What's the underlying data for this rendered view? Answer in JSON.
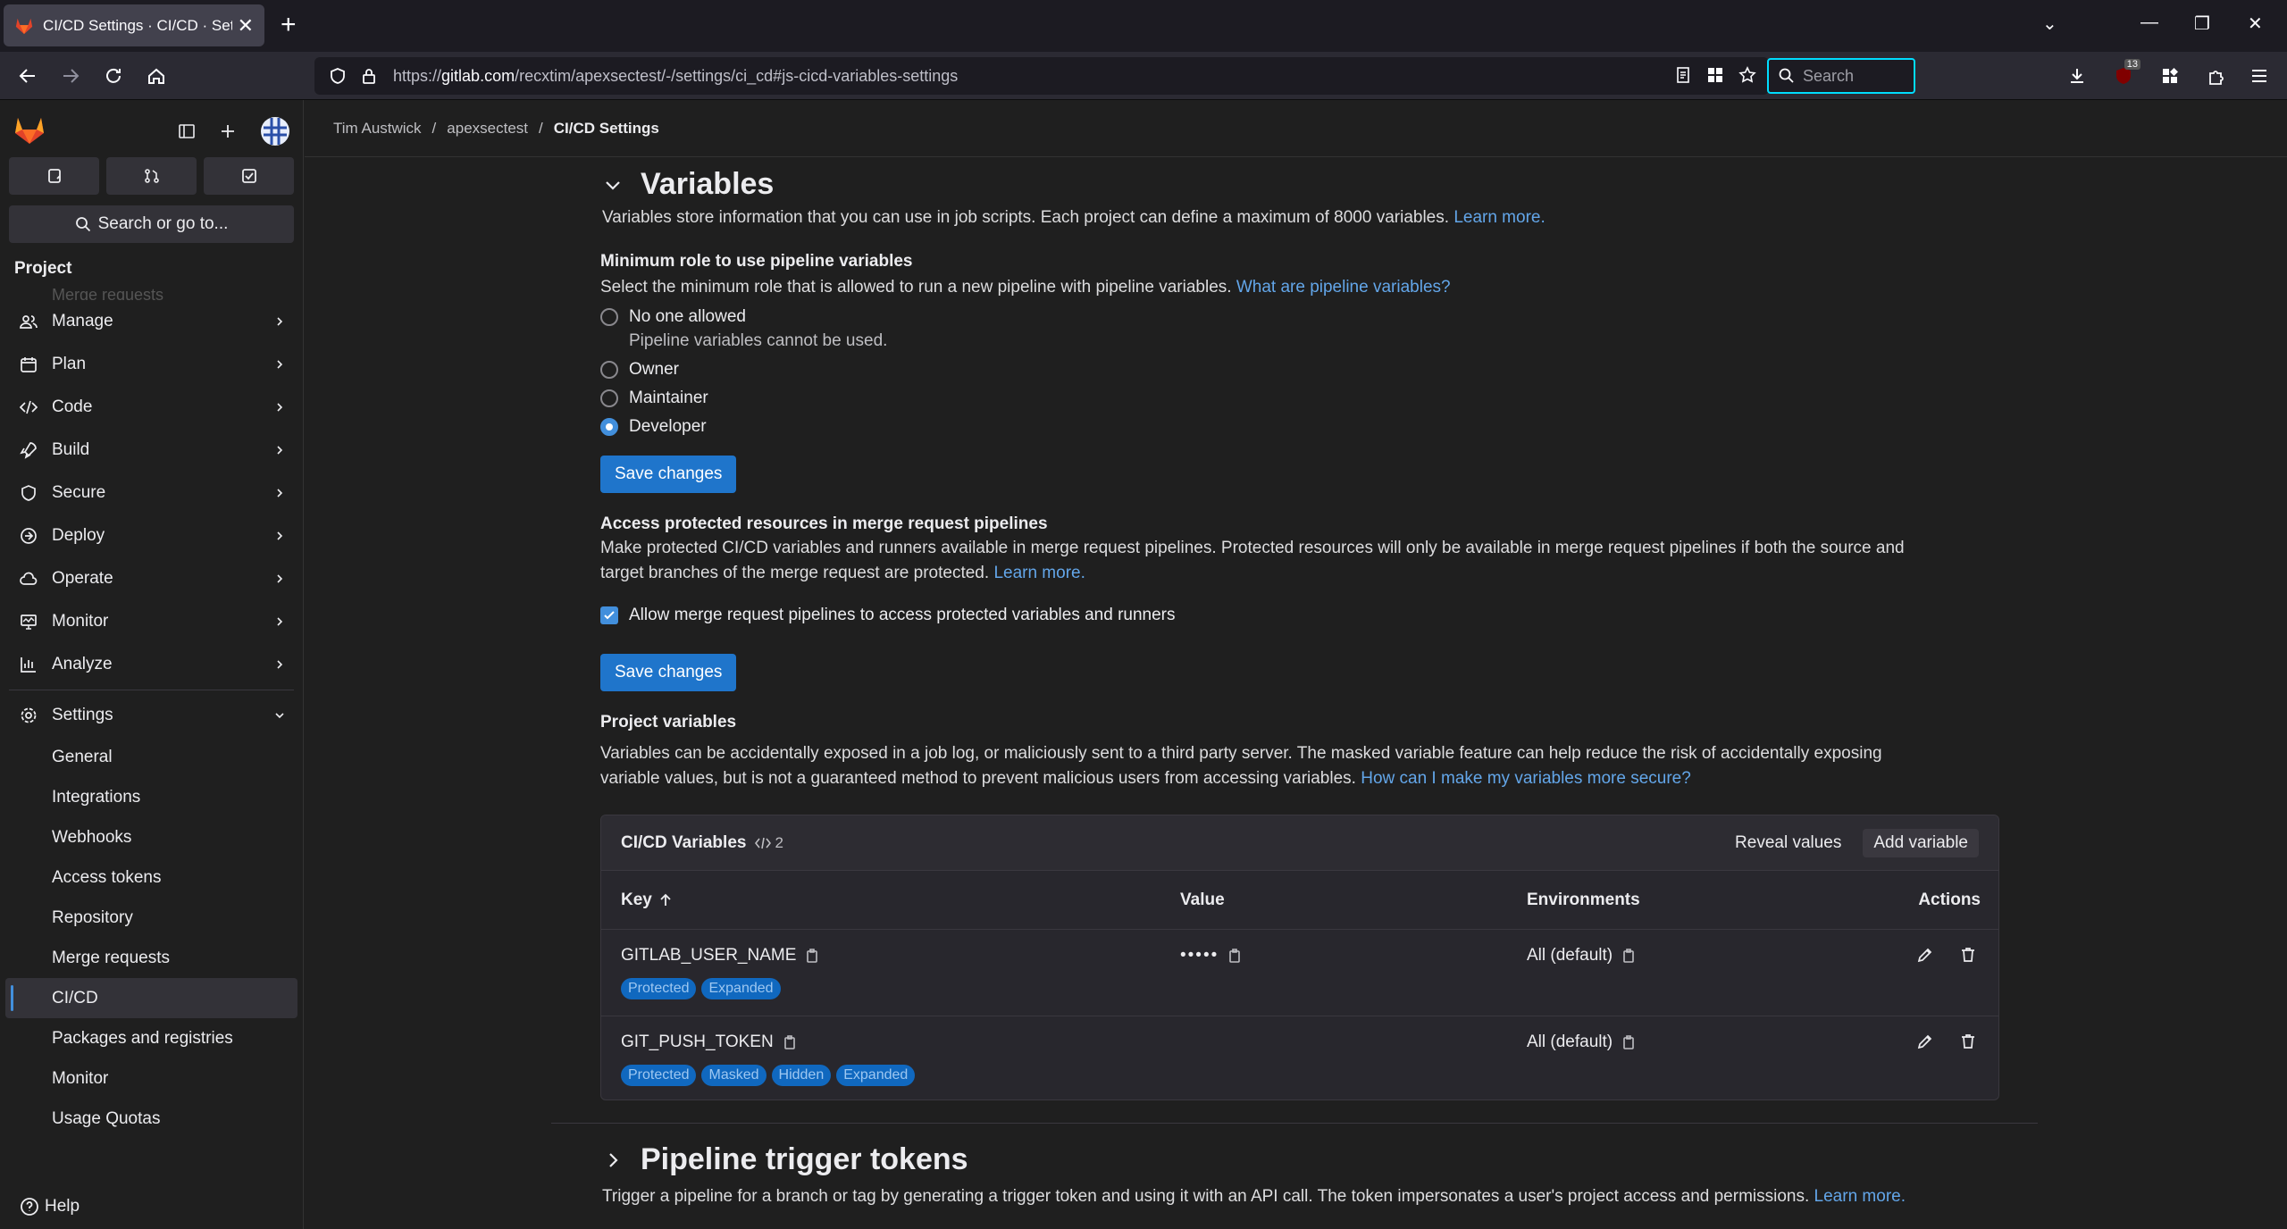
{
  "browser": {
    "tab_title": "CI/CD Settings · CI/CD · Settings",
    "url_prefix": "https://",
    "url_domain": "gitlab.com",
    "url_path": "/recxtim/apexsectest/-/settings/ci_cd#js-cicd-variables-settings",
    "search_placeholder": "Search",
    "badge_count": "13"
  },
  "sidebar": {
    "search_label": "Search or go to...",
    "section": "Project",
    "faded_item": "Merge requests",
    "nav": [
      {
        "label": "Manage",
        "icon": "users-icon"
      },
      {
        "label": "Plan",
        "icon": "calendar-icon"
      },
      {
        "label": "Code",
        "icon": "code-icon"
      },
      {
        "label": "Build",
        "icon": "rocket-icon"
      },
      {
        "label": "Secure",
        "icon": "shield-icon"
      },
      {
        "label": "Deploy",
        "icon": "deploy-icon"
      },
      {
        "label": "Operate",
        "icon": "cloud-icon"
      },
      {
        "label": "Monitor",
        "icon": "monitor-icon"
      },
      {
        "label": "Analyze",
        "icon": "chart-icon"
      }
    ],
    "settings_label": "Settings",
    "settings_items": [
      "General",
      "Integrations",
      "Webhooks",
      "Access tokens",
      "Repository",
      "Merge requests",
      "CI/CD",
      "Packages and registries",
      "Monitor",
      "Usage Quotas"
    ],
    "active_item": "CI/CD",
    "help": "Help"
  },
  "breadcrumb": [
    "Tim Austwick",
    "apexsectest",
    "CI/CD Settings"
  ],
  "variables_section": {
    "title": "Variables",
    "description": "Variables store information that you can use in job scripts. Each project can define a maximum of 8000 variables.",
    "learn_more": "Learn more.",
    "min_role": {
      "label": "Minimum role to use pipeline variables",
      "description": "Select the minimum role that is allowed to run a new pipeline with pipeline variables.",
      "link": "What are pipeline variables?",
      "options": [
        "No one allowed",
        "Owner",
        "Maintainer",
        "Developer"
      ],
      "no_one_hint": "Pipeline variables cannot be used.",
      "selected": "Developer"
    },
    "save_changes": "Save changes",
    "protected": {
      "label": "Access protected resources in merge request pipelines",
      "description_line1": "Make protected CI/CD variables and runners available in merge request pipelines. Protected resources will only be available in merge request pipelines if both the source and",
      "description_line2": "target branches of the merge request are protected.",
      "learn_more": "Learn more.",
      "checkbox": "Allow merge request pipelines to access protected variables and runners",
      "checked": true
    },
    "project_vars": {
      "label": "Project variables",
      "warning_line1": "Variables can be accidentally exposed in a job log, or maliciously sent to a third party server. The masked variable feature can help reduce the risk of accidentally exposing",
      "warning_line2": "variable values, but is not a guaranteed method to prevent malicious users from accessing variables.",
      "warning_link": "How can I make my variables more secure?"
    },
    "table": {
      "title": "CI/CD Variables",
      "count": "2",
      "reveal": "Reveal values",
      "add": "Add variable",
      "headers": {
        "key": "Key",
        "value": "Value",
        "environments": "Environments",
        "actions": "Actions"
      },
      "rows": [
        {
          "key": "GITLAB_USER_NAME",
          "value": "•••••",
          "env": "All (default)",
          "badges": [
            "Protected",
            "Expanded"
          ]
        },
        {
          "key": "GIT_PUSH_TOKEN",
          "value": "",
          "env": "All (default)",
          "badges": [
            "Protected",
            "Masked",
            "Hidden",
            "Expanded"
          ]
        }
      ]
    }
  },
  "trigger_section": {
    "title": "Pipeline trigger tokens",
    "description": "Trigger a pipeline for a branch or tag by generating a trigger token and using it with an API call. The token impersonates a user's project access and permissions.",
    "learn_more": "Learn more."
  },
  "colors": {
    "accent": "#1f75cb",
    "link": "#63a6e9",
    "badge_bg": "#1068bf",
    "background": "#1f1f1f"
  }
}
